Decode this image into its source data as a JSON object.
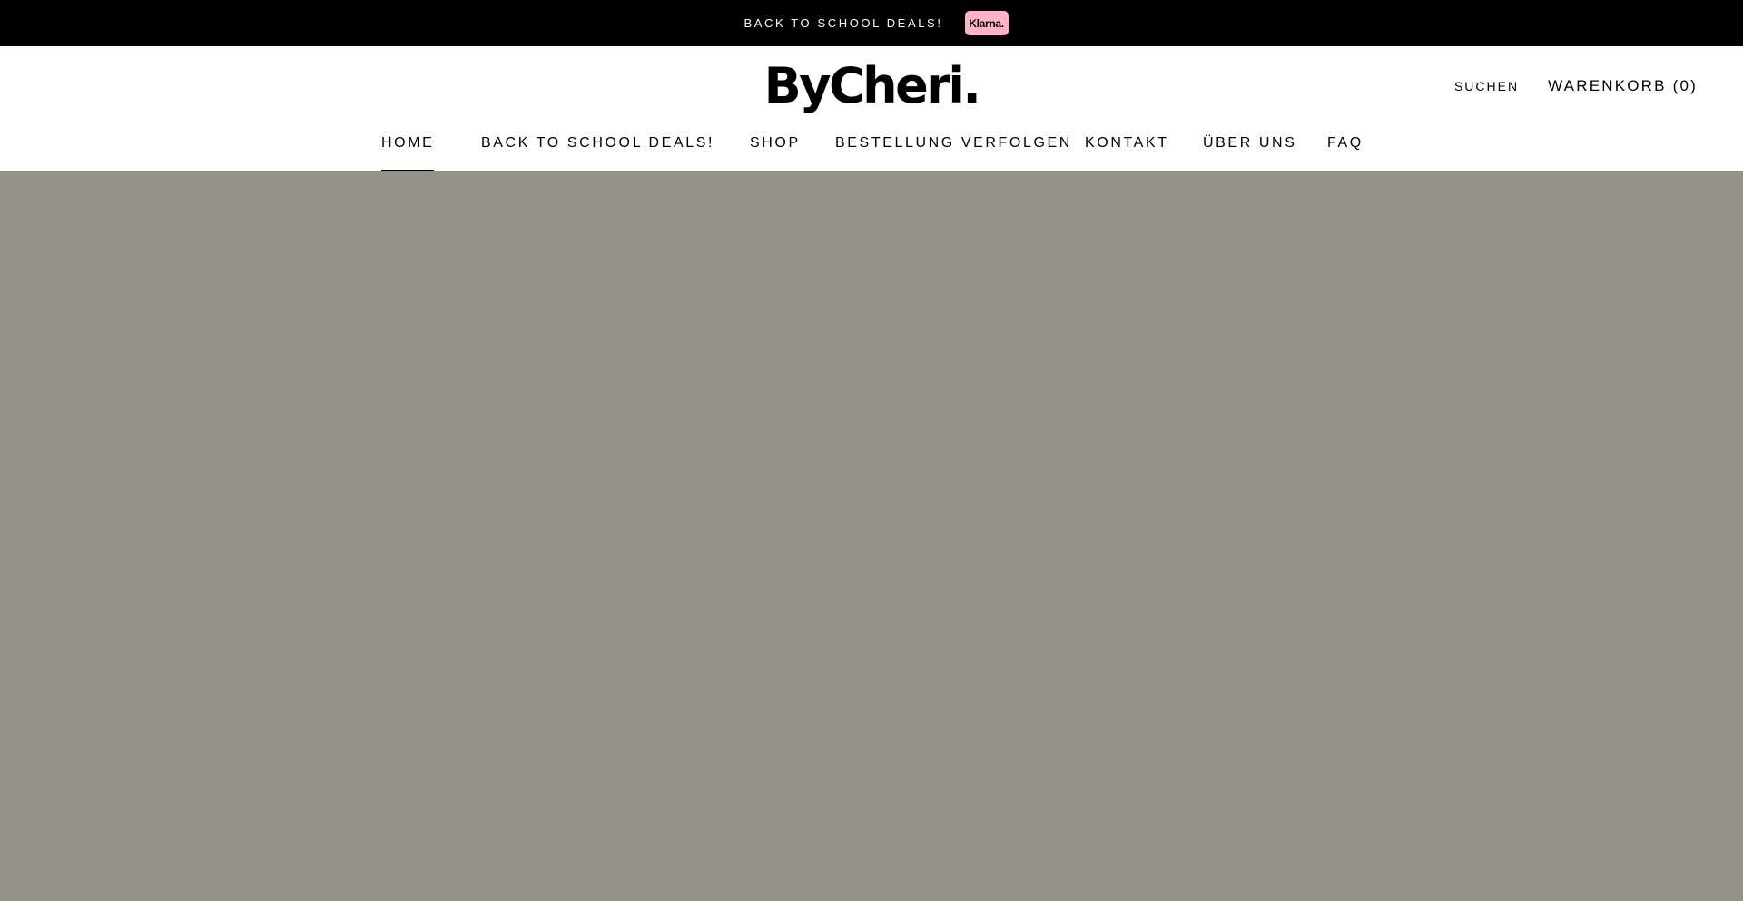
{
  "announcement": {
    "text": "BACK TO SCHOOL DEALS!",
    "badge": "Klarna.",
    "background": "#000000",
    "badge_color": "#ffb3c7"
  },
  "header": {
    "logo": "ByCheri.",
    "search_label": "SUCHEN",
    "cart_label": "WARENKORB (0)"
  },
  "nav": {
    "items": [
      {
        "label": "HOME",
        "active": true
      },
      {
        "label": "BACK TO SCHOOL DEALS!",
        "active": false
      },
      {
        "label": "SHOP",
        "active": false
      },
      {
        "label": "BESTELLUNG VERFOLGEN",
        "active": false
      },
      {
        "label": "KONTAKT",
        "active": false
      },
      {
        "label": "ÜBER UNS",
        "active": false
      },
      {
        "label": "FAQ",
        "active": false
      }
    ]
  },
  "hero": {
    "background": "#959189"
  }
}
